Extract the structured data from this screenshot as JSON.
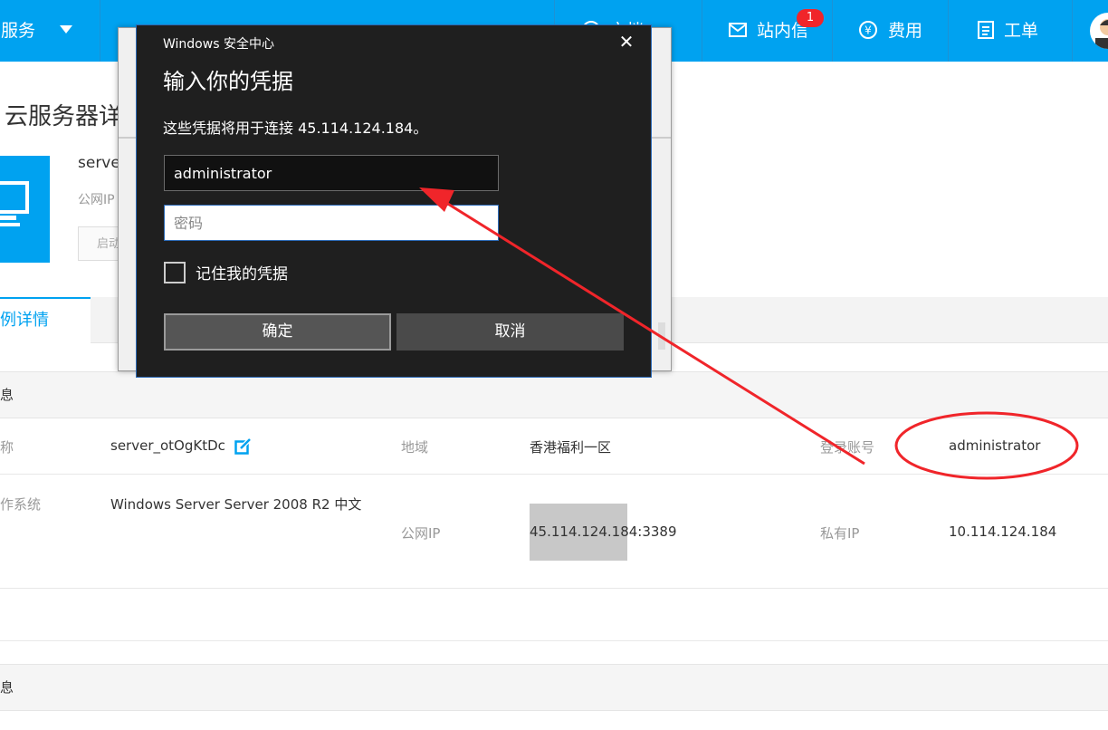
{
  "topnav": {
    "service_menu": "云服务",
    "doc_label": "文档",
    "messages_label": "站内信",
    "messages_badge": "1",
    "billing_label": "费用",
    "ticket_label": "工单"
  },
  "page": {
    "title": "云服务器详",
    "server_name_partial": "serve",
    "public_ip_label_partial": "公网IP",
    "start_button_partial": "启动"
  },
  "tabs": {
    "active": "例详情"
  },
  "section1": {
    "title": "息",
    "rows": [
      {
        "label_a": "称",
        "value_a": "server_otOgKtDc",
        "label_b": "地域",
        "value_b": "香港福利一区",
        "label_c": "登录账号",
        "value_c": "administrator"
      },
      {
        "label_a": "作系统",
        "value_a": "Windows Server Server 2008 R2 中文",
        "label_b": "公网IP",
        "value_b": "45.114.124.184:3389",
        "label_c": "私有IP",
        "value_c": "10.114.124.184"
      }
    ]
  },
  "section2": {
    "title": "息"
  },
  "dialog": {
    "window_title": "Windows 安全中心",
    "heading": "输入你的凭据",
    "description": "这些凭据将用于连接 45.114.124.184。",
    "username_value": "administrator",
    "password_placeholder": "密码",
    "remember_label": "记住我的凭据",
    "ok_label": "确定",
    "cancel_label": "取消",
    "close_glyph": "✕"
  },
  "colors": {
    "brand": "#00a2f0",
    "annotation_red": "#f0252a"
  }
}
